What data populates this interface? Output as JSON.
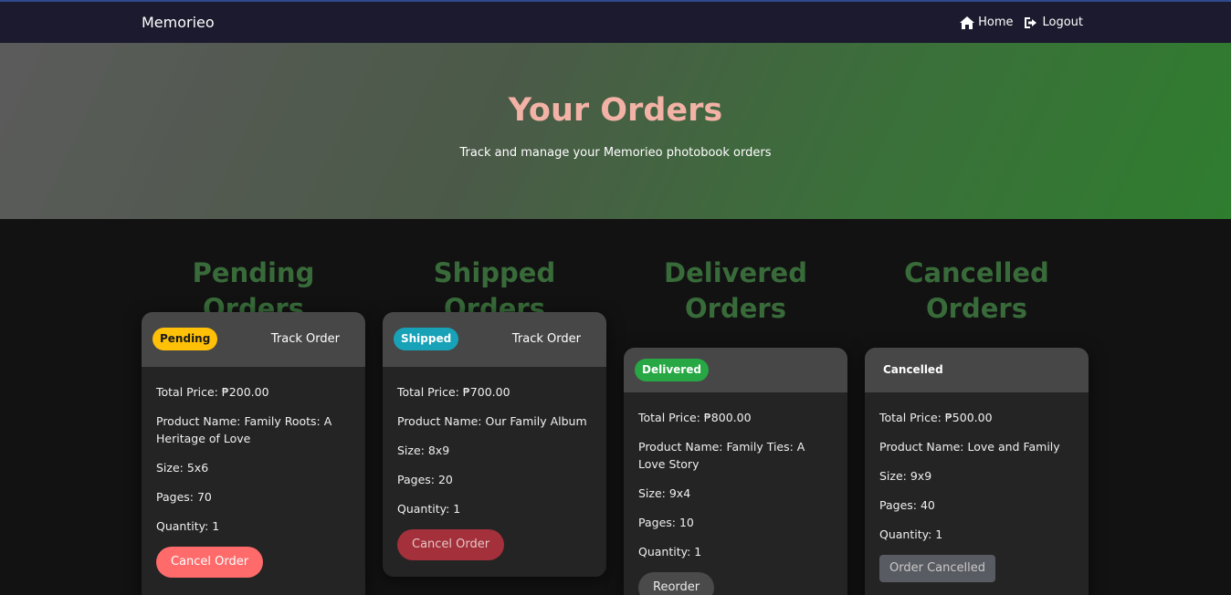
{
  "nav": {
    "brand": "Memorieo",
    "home": "Home",
    "logout": "Logout"
  },
  "hero": {
    "title": "Your Orders",
    "subtitle": "Track and manage your Memorieo photobook orders"
  },
  "columns": {
    "pending": {
      "title": "Pending Orders",
      "badge": "Pending",
      "track": "Track Order",
      "total": "Total Price: ₱200.00",
      "product": "Product Name: Family Roots: A Heritage of Love",
      "size": "Size: 5x6",
      "pages": "Pages: 70",
      "quantity": "Quantity: 1",
      "action": "Cancel Order"
    },
    "shipped": {
      "title": "Shipped Orders",
      "badge": "Shipped",
      "track": "Track Order",
      "total": "Total Price: ₱700.00",
      "product": "Product Name: Our Family Album",
      "size": "Size: 8x9",
      "pages": "Pages: 20",
      "quantity": "Quantity: 1",
      "action": "Cancel Order"
    },
    "delivered": {
      "title_line1": "Delivered",
      "title_line2": "Orders",
      "badge": "Delivered",
      "total": "Total Price: ₱800.00",
      "product": "Product Name: Family Ties: A Love Story",
      "size": "Size: 9x4",
      "pages": "Pages: 10",
      "quantity": "Quantity: 1",
      "action": "Reorder"
    },
    "cancelled": {
      "title_line1": "Cancelled",
      "title_line2": "Orders",
      "badge": "Cancelled",
      "total": "Total Price: ₱500.00",
      "product": "Product Name: Love and Family",
      "size": "Size: 9x9",
      "pages": "Pages: 40",
      "quantity": "Quantity: 1",
      "action": "Order Cancelled"
    }
  },
  "colors": {
    "navbar": "#1b1a2e",
    "hero_title": "#f3b2a6",
    "column_title": "#386b39",
    "badge_pending": "#ffc107",
    "badge_shipped": "#17a2b8",
    "badge_delivered": "#28a745",
    "cancel_button": "#ff6b6b"
  },
  "icons": {
    "home": "home-icon",
    "logout": "logout-icon"
  }
}
